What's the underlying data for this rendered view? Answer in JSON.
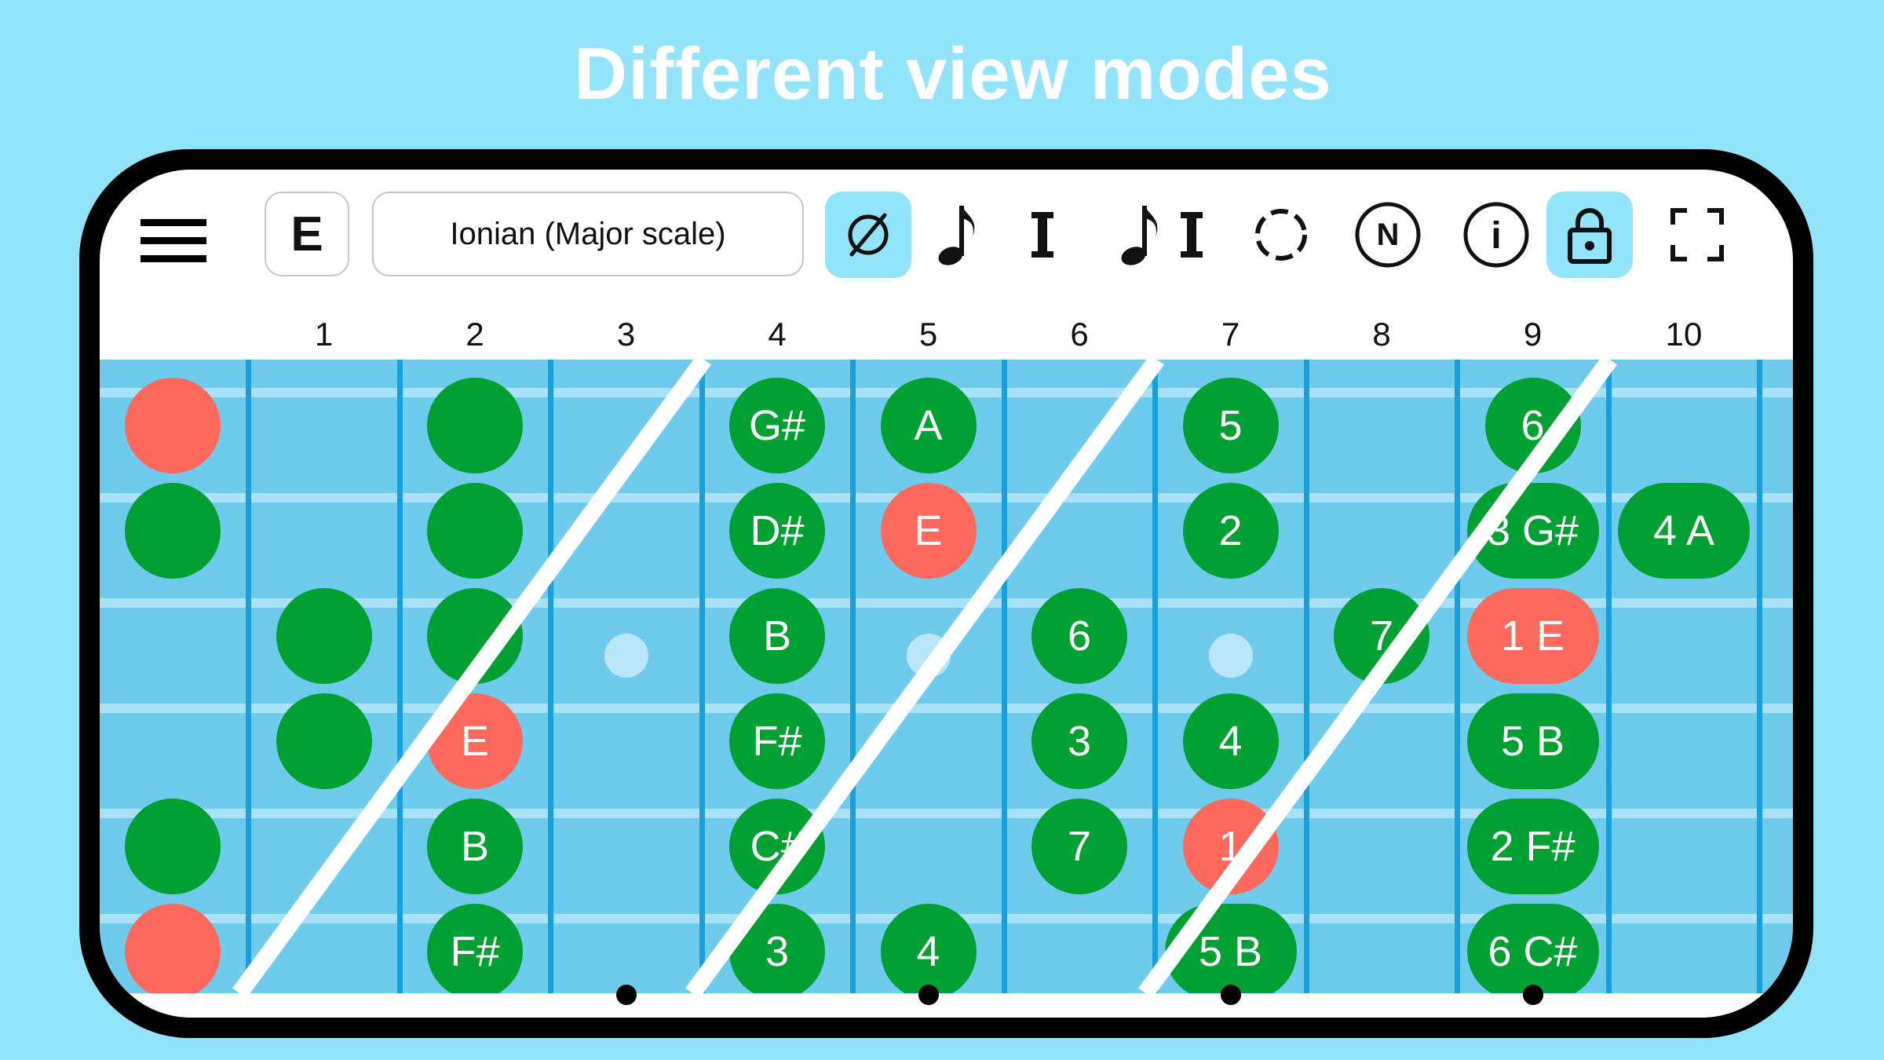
{
  "headline": "Different view modes",
  "toolbar": {
    "key_label": "E",
    "scale_label": "Ionian (Major scale)",
    "buttons": [
      {
        "name": "hide-notes-button",
        "icon": "empty-set-icon",
        "active": true
      },
      {
        "name": "note-names-button",
        "icon": "eighth-note-icon",
        "active": false
      },
      {
        "name": "intervals-button",
        "icon": "roman-numeral-icon",
        "active": false
      },
      {
        "name": "notes-intervals-button",
        "icon": "note-and-numeral-icon",
        "active": false
      },
      {
        "name": "circle-button",
        "icon": "dashed-circle-icon",
        "active": false
      },
      {
        "name": "n-button",
        "icon": "circled-n-icon",
        "active": false
      },
      {
        "name": "info-button",
        "icon": "info-icon",
        "active": false
      },
      {
        "name": "lock-button",
        "icon": "lock-icon",
        "active": true
      },
      {
        "name": "fullscreen-button",
        "icon": "fullscreen-icon",
        "active": false
      }
    ],
    "n_glyph": "N",
    "info_glyph": "i"
  },
  "fret_numbers": [
    "1",
    "2",
    "3",
    "4",
    "5",
    "6",
    "7",
    "8",
    "9",
    "10"
  ],
  "notes": [
    {
      "fret": 0,
      "string": 1,
      "label": "",
      "color": "red"
    },
    {
      "fret": 0,
      "string": 2,
      "label": "",
      "color": "green"
    },
    {
      "fret": 0,
      "string": 5,
      "label": "",
      "color": "green"
    },
    {
      "fret": 0,
      "string": 6,
      "label": "",
      "color": "red"
    },
    {
      "fret": 1,
      "string": 3,
      "label": "",
      "color": "green"
    },
    {
      "fret": 1,
      "string": 4,
      "label": "",
      "color": "green"
    },
    {
      "fret": 2,
      "string": 1,
      "label": "",
      "color": "green"
    },
    {
      "fret": 2,
      "string": 2,
      "label": "",
      "color": "green"
    },
    {
      "fret": 2,
      "string": 3,
      "label": "",
      "color": "green"
    },
    {
      "fret": 2,
      "string": 4,
      "label": "E",
      "color": "red"
    },
    {
      "fret": 2,
      "string": 5,
      "label": "B",
      "color": "green"
    },
    {
      "fret": 2,
      "string": 6,
      "label": "F#",
      "color": "green"
    },
    {
      "fret": 4,
      "string": 1,
      "label": "G#",
      "color": "green"
    },
    {
      "fret": 4,
      "string": 2,
      "label": "D#",
      "color": "green"
    },
    {
      "fret": 4,
      "string": 3,
      "label": "B",
      "color": "green"
    },
    {
      "fret": 4,
      "string": 4,
      "label": "F#",
      "color": "green"
    },
    {
      "fret": 4,
      "string": 5,
      "label": "C#",
      "color": "green"
    },
    {
      "fret": 4,
      "string": 6,
      "label": "3",
      "color": "green"
    },
    {
      "fret": 5,
      "string": 1,
      "label": "A",
      "color": "green"
    },
    {
      "fret": 5,
      "string": 2,
      "label": "E",
      "color": "red"
    },
    {
      "fret": 5,
      "string": 6,
      "label": "4",
      "color": "green"
    },
    {
      "fret": 6,
      "string": 3,
      "label": "6",
      "color": "green"
    },
    {
      "fret": 6,
      "string": 4,
      "label": "3",
      "color": "green"
    },
    {
      "fret": 6,
      "string": 5,
      "label": "7",
      "color": "green"
    },
    {
      "fret": 7,
      "string": 1,
      "label": "5",
      "color": "green"
    },
    {
      "fret": 7,
      "string": 2,
      "label": "2",
      "color": "green"
    },
    {
      "fret": 7,
      "string": 4,
      "label": "4",
      "color": "green"
    },
    {
      "fret": 7,
      "string": 5,
      "label": "1",
      "color": "red"
    },
    {
      "fret": 7,
      "string": 6,
      "label": "5 B",
      "color": "green"
    },
    {
      "fret": 8,
      "string": 3,
      "label": "7",
      "color": "green"
    },
    {
      "fret": 9,
      "string": 1,
      "label": "6",
      "color": "green"
    },
    {
      "fret": 9,
      "string": 2,
      "label": "3 G#",
      "color": "green"
    },
    {
      "fret": 9,
      "string": 3,
      "label": "1 E",
      "color": "red"
    },
    {
      "fret": 9,
      "string": 4,
      "label": "5 B",
      "color": "green"
    },
    {
      "fret": 9,
      "string": 5,
      "label": "2 F#",
      "color": "green"
    },
    {
      "fret": 9,
      "string": 6,
      "label": "6 C#",
      "color": "green"
    },
    {
      "fret": 10,
      "string": 2,
      "label": "4 A",
      "color": "green"
    }
  ],
  "inlay_frets": [
    3,
    5,
    7,
    9
  ],
  "colors": {
    "background": "#93e3fa",
    "note_green": "#00a032",
    "note_red": "#fd6a5d",
    "fretboard": "#6ecbec",
    "fret_wire": "#1a9fdc",
    "active_button": "#93e3fa"
  }
}
